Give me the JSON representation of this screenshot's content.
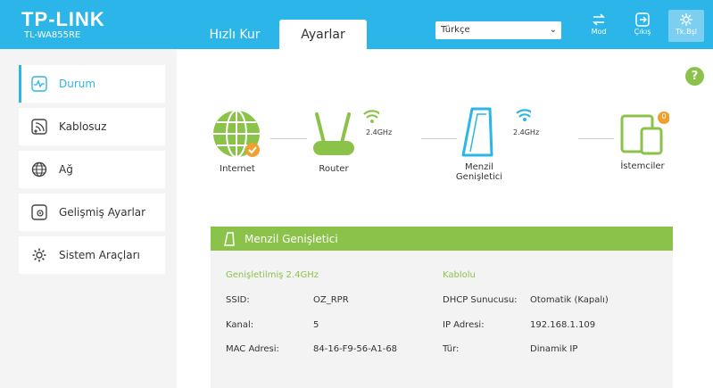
{
  "header": {
    "brand": "TP-LINK",
    "model": "TL-WA855RE",
    "tabs": [
      {
        "label": "Hızlı Kur"
      },
      {
        "label": "Ayarlar"
      }
    ],
    "language": "Türkçe",
    "buttons": {
      "mode": "Mod",
      "logout": "Çıkış",
      "reboot": "Tk.Bşl"
    }
  },
  "sidebar": {
    "items": [
      {
        "label": "Durum"
      },
      {
        "label": "Kablosuz"
      },
      {
        "label": "Ağ"
      },
      {
        "label": "Gelişmiş Ayarlar"
      },
      {
        "label": "Sistem Araçları"
      }
    ]
  },
  "help": "?",
  "topology": {
    "internet": "Internet",
    "router": "Router",
    "extender_line1": "Menzil",
    "extender_line2": "Genişletici",
    "clients": "İstemciler",
    "band1": "2.4GHz",
    "band2": "2.4GHz",
    "client_count": "0"
  },
  "panel": {
    "title": "Menzil Genişletici",
    "extended_section": "Genişletilmiş 2.4GHz",
    "wired_section": "Kablolu",
    "left": [
      {
        "key": "SSID:",
        "value": "OZ_RPR"
      },
      {
        "key": "Kanal:",
        "value": "5"
      },
      {
        "key": "MAC Adresi:",
        "value": "84-16-F9-56-A1-68"
      }
    ],
    "right": [
      {
        "key": "DHCP Sunucusu:",
        "value": "Otomatik (Kapalı)"
      },
      {
        "key": "IP Adresi:",
        "value": "192.168.1.109"
      },
      {
        "key": "Tür:",
        "value": "Dinamik IP"
      }
    ]
  },
  "colors": {
    "header": "#2cb5e8",
    "accent_green": "#8bc34a",
    "badge_orange": "#f0a030"
  }
}
